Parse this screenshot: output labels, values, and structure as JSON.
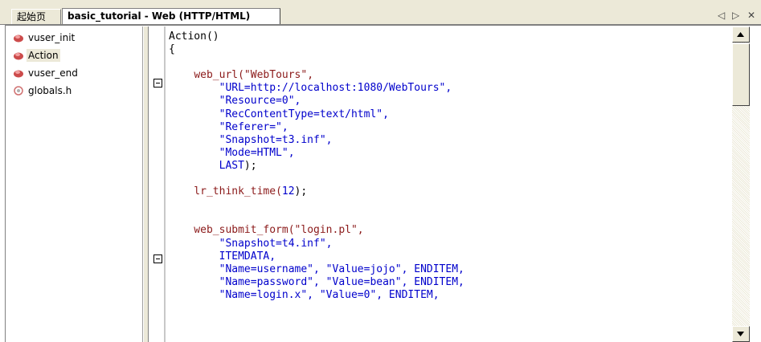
{
  "tabs": [
    {
      "label": "起始页"
    },
    {
      "label": "basic_tutorial - Web (HTTP/HTML)"
    }
  ],
  "tab_controls": {
    "prev": "◁",
    "next": "▷",
    "close": "✕"
  },
  "tree": [
    {
      "label": "vuser_init",
      "icon": "script-icon"
    },
    {
      "label": "Action",
      "icon": "script-icon",
      "selected": true
    },
    {
      "label": "vuser_end",
      "icon": "script-icon"
    },
    {
      "label": "globals.h",
      "icon": "header-file-icon"
    }
  ],
  "code_lines": [
    [
      {
        "t": "Action()",
        "c": ""
      }
    ],
    [
      {
        "t": "{",
        "c": ""
      }
    ],
    [
      {
        "t": "",
        "c": ""
      }
    ],
    [
      {
        "t": "    ",
        "c": ""
      },
      {
        "t": "web_url",
        "c": "fn"
      },
      {
        "t": "(\"WebTours\",",
        "c": "fn"
      }
    ],
    [
      {
        "t": "        \"URL=http://localhost:1080/WebTours\",",
        "c": "str"
      }
    ],
    [
      {
        "t": "        \"Resource=0\",",
        "c": "str"
      }
    ],
    [
      {
        "t": "        \"RecContentType=text/html\",",
        "c": "str"
      }
    ],
    [
      {
        "t": "        \"Referer=\",",
        "c": "str"
      }
    ],
    [
      {
        "t": "        \"Snapshot=t3.inf\",",
        "c": "str"
      }
    ],
    [
      {
        "t": "        \"Mode=HTML\",",
        "c": "str"
      }
    ],
    [
      {
        "t": "        LAST",
        "c": "kw"
      },
      {
        "t": ");",
        "c": ""
      }
    ],
    [
      {
        "t": "",
        "c": ""
      }
    ],
    [
      {
        "t": "    lr_think_time",
        "c": "fn"
      },
      {
        "t": "(",
        "c": "fn"
      },
      {
        "t": "12",
        "c": "num"
      },
      {
        "t": ");",
        "c": ""
      }
    ],
    [
      {
        "t": "",
        "c": ""
      }
    ],
    [
      {
        "t": "",
        "c": ""
      }
    ],
    [
      {
        "t": "    web_submit_form",
        "c": "fn"
      },
      {
        "t": "(\"login.pl\",",
        "c": "fn"
      }
    ],
    [
      {
        "t": "        \"Snapshot=t4.inf\",",
        "c": "str"
      }
    ],
    [
      {
        "t": "        ITEMDATA,",
        "c": "kw"
      }
    ],
    [
      {
        "t": "        \"Name=username\", \"Value=jojo\", ENDITEM,",
        "c": "str"
      }
    ],
    [
      {
        "t": "        \"Name=password\", \"Value=bean\", ENDITEM,",
        "c": "str"
      }
    ],
    [
      {
        "t": "        \"Name=login.x\", \"Value=0\", ENDITEM,",
        "c": "str"
      }
    ]
  ],
  "colors": {
    "function": "#8b1a1a",
    "string": "#0000cc",
    "tab_bar": "#ece9d8"
  }
}
